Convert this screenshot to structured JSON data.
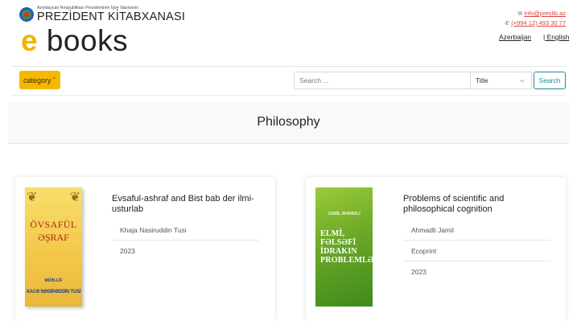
{
  "header": {
    "org_small": "Azərbaycan Respublikası Prezidentinin İşlər İdarəsinin",
    "org_big": "PREZİDENT KİTABXANASI",
    "brand_e": "e",
    "brand_rest": " books",
    "email": "info@preslib.az",
    "phone": "(+994 12) 493 30 77",
    "lang_az": "Azerbaijan",
    "lang_en": "| English",
    "email_icon": "envelope-icon",
    "phone_icon": "phone-icon"
  },
  "toolbar": {
    "category_label": "category ˇ",
    "search_placeholder": "Search ...",
    "search_value": "",
    "select_value": "Title",
    "search_button": "Search"
  },
  "page_title": "Philosophy",
  "books": [
    {
      "title": "Evsaful-ashraf and Bist bab der ilmi-usturlab",
      "author": "Khaja Nasiruddin Tusi",
      "publisher": "",
      "year": "2023",
      "cover_title_1": "ÖVSAFÜL",
      "cover_title_2": "ƏŞRAF",
      "cover_author_label": "MÜƏLLİF",
      "cover_author": "XACƏ NƏSİRƏDDİN TUSİ"
    },
    {
      "title": "Problems of scientific and philosophical cognition",
      "author": "Ahmadli Jamil",
      "publisher": "Ecoprint",
      "year": "2023",
      "cover_author": "CƏMİL ƏHMƏDLİ",
      "cover_title": "ELMİ, FƏLSƏFİ İDRAKIN PROBLEMLƏRİ"
    }
  ],
  "colors": {
    "accent_yellow": "#f5b800",
    "link_red": "#d9433c",
    "search_teal": "#1d8a99"
  }
}
